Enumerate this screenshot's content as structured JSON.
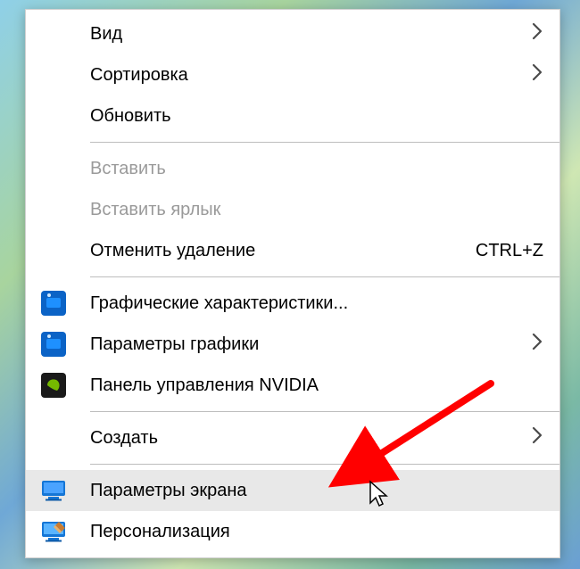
{
  "menu": {
    "items": [
      {
        "id": "view",
        "label": "Вид",
        "submenu": true,
        "disabled": false
      },
      {
        "id": "sort",
        "label": "Сортировка",
        "submenu": true,
        "disabled": false
      },
      {
        "id": "refresh",
        "label": "Обновить",
        "submenu": false,
        "disabled": false
      },
      {
        "sep": true
      },
      {
        "id": "paste",
        "label": "Вставить",
        "submenu": false,
        "disabled": true
      },
      {
        "id": "paste-link",
        "label": "Вставить ярлык",
        "submenu": false,
        "disabled": true
      },
      {
        "id": "undo-delete",
        "label": "Отменить удаление",
        "shortcut": "CTRL+Z",
        "submenu": false,
        "disabled": false
      },
      {
        "sep": true
      },
      {
        "id": "intel-gfx-props",
        "label": "Графические характеристики...",
        "icon": "intel-icon",
        "submenu": false,
        "disabled": false
      },
      {
        "id": "intel-gfx-params",
        "label": "Параметры графики",
        "icon": "intel-icon",
        "submenu": true,
        "disabled": false
      },
      {
        "id": "nvidia-cp",
        "label": "Панель управления NVIDIA",
        "icon": "nvidia-icon",
        "submenu": false,
        "disabled": false
      },
      {
        "sep": true
      },
      {
        "id": "new",
        "label": "Создать",
        "submenu": true,
        "disabled": false
      },
      {
        "sep": true
      },
      {
        "id": "display-settings",
        "label": "Параметры экрана",
        "icon": "monitor-icon",
        "submenu": false,
        "disabled": false,
        "hovered": true
      },
      {
        "id": "personalize",
        "label": "Персонализация",
        "icon": "personalize-icon",
        "submenu": false,
        "disabled": false
      }
    ]
  },
  "annotation": {
    "arrow_color": "#ff0000"
  }
}
